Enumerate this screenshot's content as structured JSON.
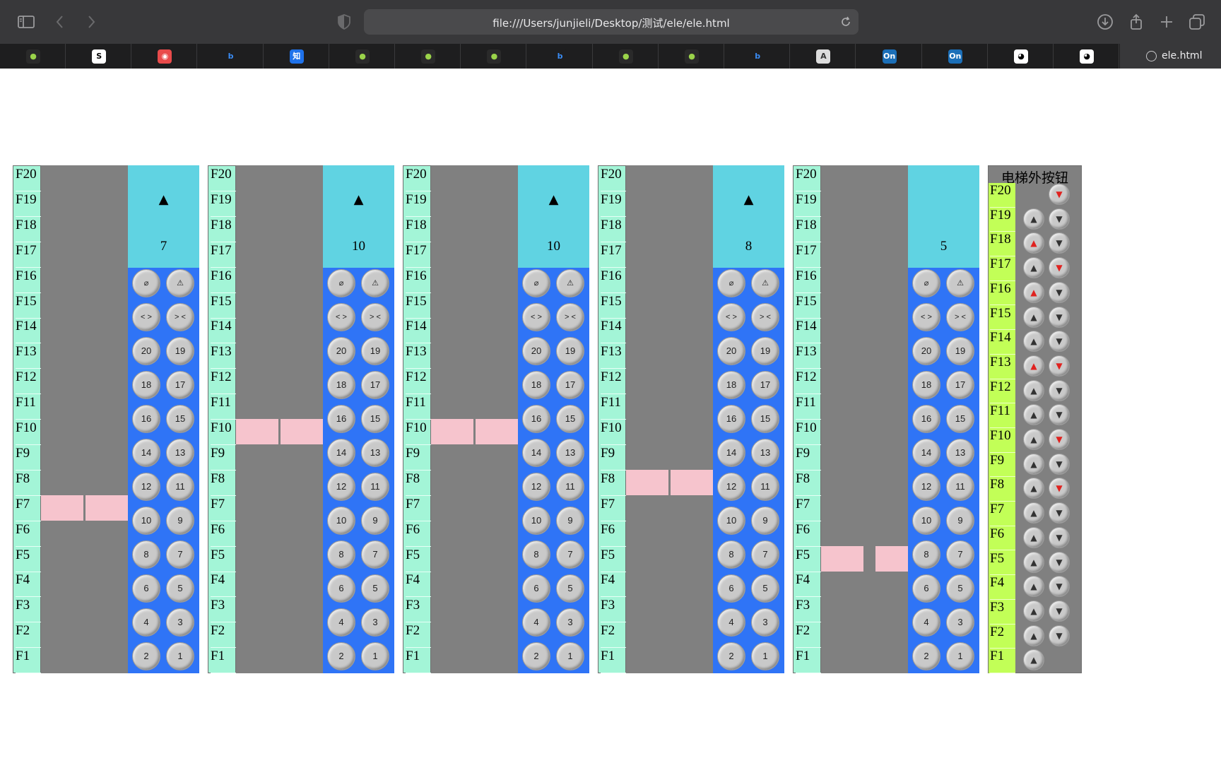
{
  "browser": {
    "url": "file:///Users/junjieli/Desktop/测试/ele/ele.html",
    "favorites": [
      {
        "label": "●",
        "bg": "#2a2a2a",
        "fg": "#9bd44a"
      },
      {
        "label": "S",
        "bg": "#ffffff",
        "fg": "#000000"
      },
      {
        "label": "◉",
        "bg": "#e94b4b",
        "fg": "#ffffff"
      },
      {
        "label": "b",
        "bg": "#1e1e1f",
        "fg": "#3a8cf5"
      },
      {
        "label": "知",
        "bg": "#1f72ea",
        "fg": "#ffffff"
      },
      {
        "label": "●",
        "bg": "#2a2a2a",
        "fg": "#9bd44a"
      },
      {
        "label": "●",
        "bg": "#2a2a2a",
        "fg": "#9bd44a"
      },
      {
        "label": "●",
        "bg": "#2a2a2a",
        "fg": "#9bd44a"
      },
      {
        "label": "b",
        "bg": "#1e1e1f",
        "fg": "#3a8cf5"
      },
      {
        "label": "●",
        "bg": "#2a2a2a",
        "fg": "#9bd44a"
      },
      {
        "label": "●",
        "bg": "#2a2a2a",
        "fg": "#9bd44a"
      },
      {
        "label": "b",
        "bg": "#1e1e1f",
        "fg": "#3a8cf5"
      },
      {
        "label": "A",
        "bg": "#dcdcdc",
        "fg": "#333333"
      },
      {
        "label": "On",
        "bg": "#1b6fb8",
        "fg": "#ffffff"
      },
      {
        "label": "On",
        "bg": "#1b6fb8",
        "fg": "#ffffff"
      },
      {
        "label": "◕",
        "bg": "#ffffff",
        "fg": "#000000"
      },
      {
        "label": "◕",
        "bg": "#ffffff",
        "fg": "#000000"
      }
    ],
    "active_tab_label": "ele.html"
  },
  "floors": [
    "F20",
    "F19",
    "F18",
    "F17",
    "F16",
    "F15",
    "F14",
    "F13",
    "F12",
    "F11",
    "F10",
    "F9",
    "F8",
    "F7",
    "F6",
    "F5",
    "F4",
    "F3",
    "F2",
    "F1"
  ],
  "elevators": [
    {
      "direction": "▲",
      "current": "7",
      "car_floor": 7,
      "doors_open": false
    },
    {
      "direction": "▲",
      "current": "10",
      "car_floor": 10,
      "doors_open": false
    },
    {
      "direction": "▲",
      "current": "10",
      "car_floor": 10,
      "doors_open": false
    },
    {
      "direction": "▲",
      "current": "8",
      "car_floor": 8,
      "doors_open": false
    },
    {
      "direction": "",
      "current": "5",
      "car_floor": 5,
      "doors_open": true
    }
  ],
  "panel_buttons": [
    [
      "⌀",
      "⚠"
    ],
    [
      "< >",
      "> <"
    ],
    [
      "20",
      "19"
    ],
    [
      "18",
      "17"
    ],
    [
      "16",
      "15"
    ],
    [
      "14",
      "13"
    ],
    [
      "12",
      "11"
    ],
    [
      "10",
      "9"
    ],
    [
      "8",
      "7"
    ],
    [
      "6",
      "5"
    ],
    [
      "4",
      "3"
    ],
    [
      "2",
      "1"
    ]
  ],
  "outside_panel": {
    "title": "电梯外按钮",
    "up_symbol": "▲",
    "down_symbol": "▼",
    "calls": [
      {
        "floor": "F20",
        "up": null,
        "down": true
      },
      {
        "floor": "F19",
        "up": false,
        "down": false
      },
      {
        "floor": "F18",
        "up": true,
        "down": false
      },
      {
        "floor": "F17",
        "up": false,
        "down": true
      },
      {
        "floor": "F16",
        "up": true,
        "down": false
      },
      {
        "floor": "F15",
        "up": false,
        "down": false
      },
      {
        "floor": "F14",
        "up": false,
        "down": false
      },
      {
        "floor": "F13",
        "up": true,
        "down": true
      },
      {
        "floor": "F12",
        "up": false,
        "down": false
      },
      {
        "floor": "F11",
        "up": false,
        "down": false
      },
      {
        "floor": "F10",
        "up": false,
        "down": true
      },
      {
        "floor": "F9",
        "up": false,
        "down": false
      },
      {
        "floor": "F8",
        "up": false,
        "down": true
      },
      {
        "floor": "F7",
        "up": false,
        "down": false
      },
      {
        "floor": "F6",
        "up": false,
        "down": false
      },
      {
        "floor": "F5",
        "up": false,
        "down": false
      },
      {
        "floor": "F4",
        "up": false,
        "down": false
      },
      {
        "floor": "F3",
        "up": false,
        "down": false
      },
      {
        "floor": "F2",
        "up": false,
        "down": false
      },
      {
        "floor": "F1",
        "up": false,
        "down": null
      }
    ]
  },
  "colors": {
    "floor_column": "#a3f5d7",
    "shaft": "#808080",
    "car": "#f6c4cd",
    "display": "#60d3e2",
    "panel": "#2f74f6",
    "outside_floor_column": "#c2ff57",
    "lit_arrow": "#e0221f"
  }
}
